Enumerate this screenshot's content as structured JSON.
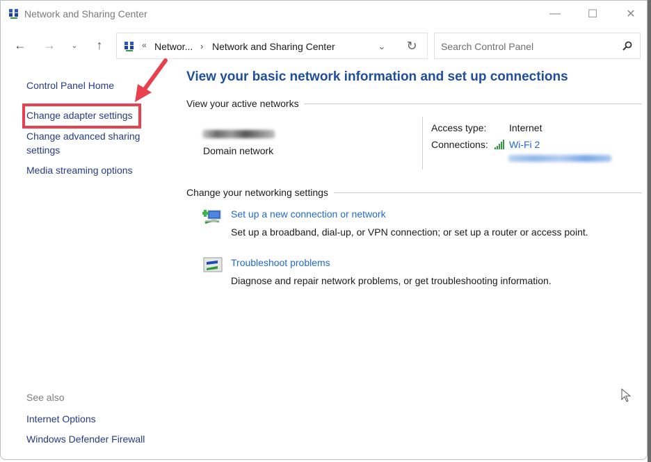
{
  "window": {
    "title": "Network and Sharing Center",
    "controls": {
      "minimize": "—",
      "maximize": "☐",
      "close": "✕"
    }
  },
  "nav": {
    "back": "←",
    "forward": "→",
    "recent": "⌄",
    "up": "↑"
  },
  "address": {
    "overflow": "«",
    "crumbs": [
      "Networ...",
      "Network and Sharing Center"
    ],
    "separator": "›",
    "dropdown": "⌄",
    "refresh": "↻"
  },
  "search": {
    "placeholder": "Search Control Panel"
  },
  "sidebar": {
    "links": [
      {
        "label": "Control Panel Home"
      },
      {
        "label": "Change adapter settings",
        "highlighted": true
      },
      {
        "label": "Change advanced sharing settings"
      },
      {
        "label": "Media streaming options"
      }
    ],
    "see_also": {
      "heading": "See also",
      "links": [
        {
          "label": "Internet Options"
        },
        {
          "label": "Windows Defender Firewall"
        }
      ]
    }
  },
  "annotation": {
    "color": "#e8414d"
  },
  "main": {
    "title": "View your basic network information and set up connections",
    "active_networks": {
      "heading": "View your active networks",
      "network_name": "(redacted)",
      "network_type": "Domain network",
      "access_type_label": "Access type:",
      "access_type_value": "Internet",
      "connections_label": "Connections:",
      "connection_link": "Wi-Fi 2",
      "ssid": "(redacted)"
    },
    "change_settings": {
      "heading": "Change your networking settings",
      "tasks": [
        {
          "icon": "new-connection-icon",
          "title": "Set up a new connection or network",
          "description": "Set up a broadband, dial-up, or VPN connection; or set up a router or access point."
        },
        {
          "icon": "troubleshoot-icon",
          "title": "Troubleshoot problems",
          "description": "Diagnose and repair network problems, or get troubleshooting information."
        }
      ]
    }
  },
  "colors": {
    "link": "#1f6ad1",
    "nav_link": "#253a86",
    "title": "#1f4e9c",
    "highlight": "#e8414d"
  }
}
